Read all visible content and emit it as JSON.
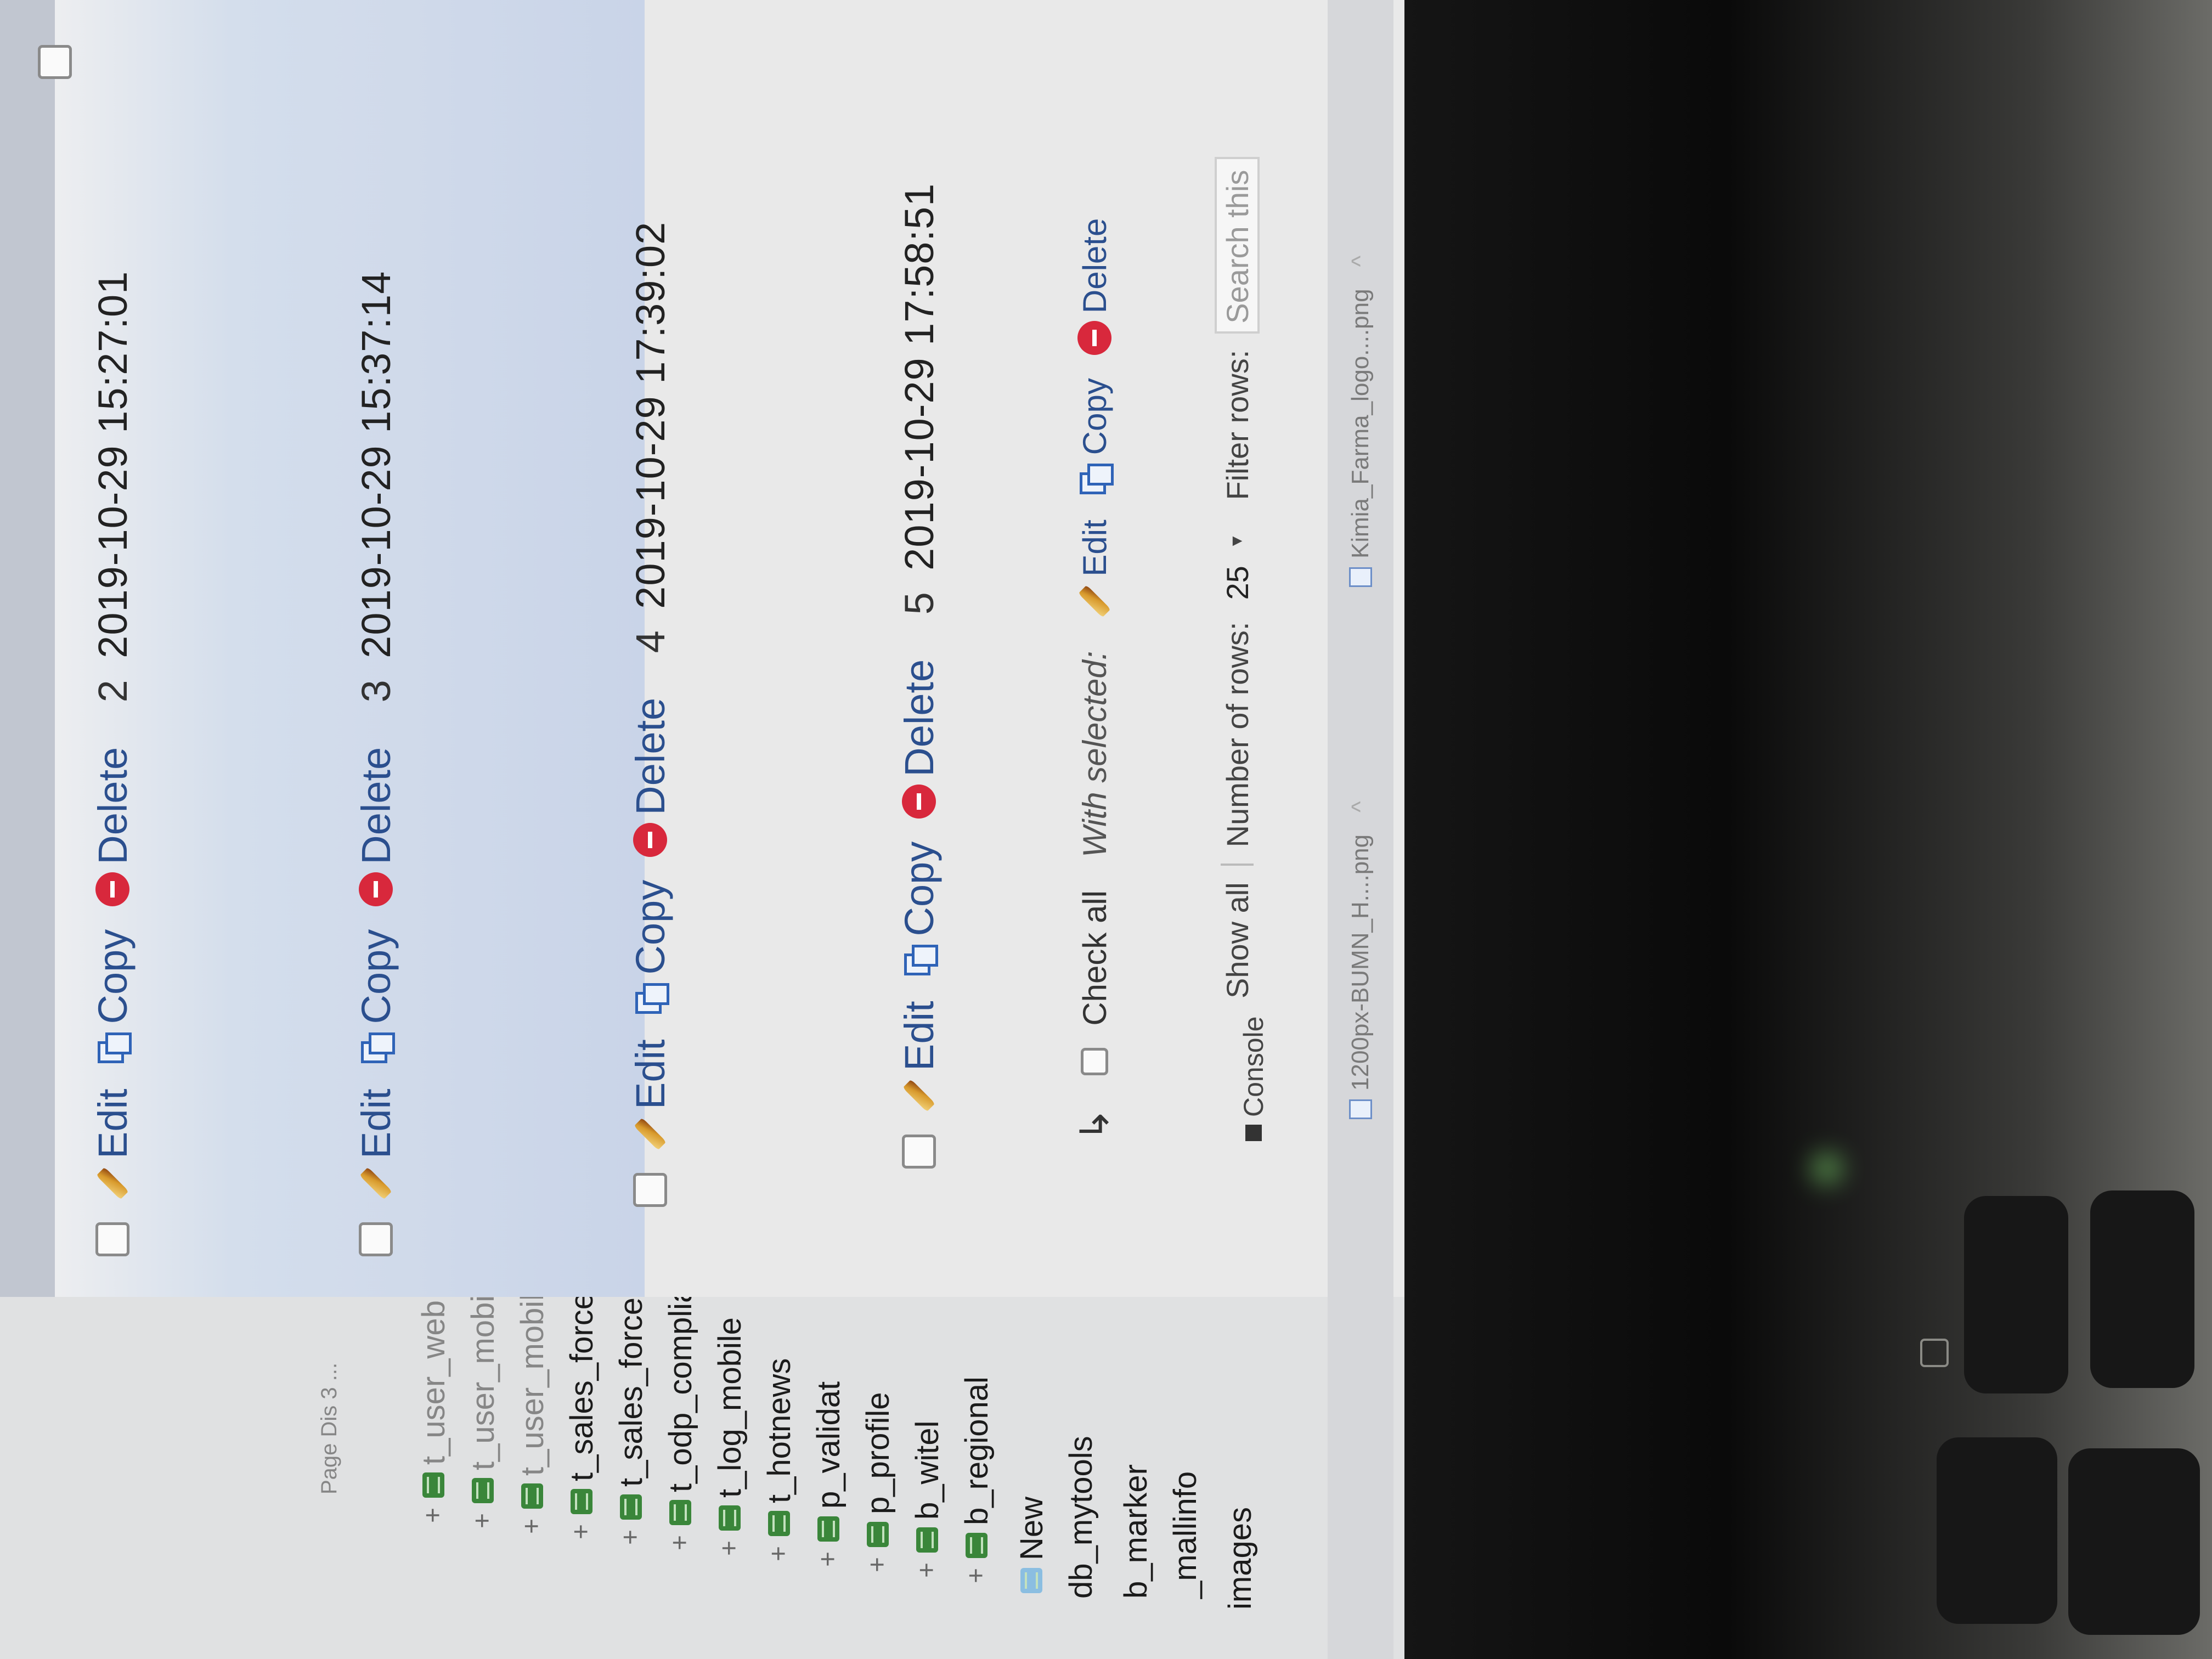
{
  "sidebar": {
    "items": [
      {
        "label": "images"
      },
      {
        "label": "_mallinfo"
      },
      {
        "label": "b_marker"
      },
      {
        "label": "db_mytools"
      },
      {
        "label": "New"
      },
      {
        "label": "b_regional"
      },
      {
        "label": "b_witel"
      },
      {
        "label": "p_profile"
      },
      {
        "label": "p_validat"
      },
      {
        "label": "t_hotnews"
      },
      {
        "label": "t_log_mobile"
      },
      {
        "label": "t_odp_compliance"
      },
      {
        "label": "t_sales_force"
      },
      {
        "label": "t_sales_force_mytools"
      },
      {
        "label": "t_user_mobile"
      },
      {
        "label": "t_user_mobile_copy"
      },
      {
        "label": "t_user_web"
      }
    ],
    "footer_text": "Page Dis 3 ..."
  },
  "actions": {
    "edit": "Edit",
    "copy": "Copy",
    "delete": "Delete"
  },
  "rows": [
    {
      "id": "2",
      "date": "2019-10-29 15:27:01"
    },
    {
      "id": "3",
      "date": "2019-10-29 15:37:14"
    },
    {
      "id": "4",
      "date": "2019-10-29 17:39:02"
    },
    {
      "id": "5",
      "date": "2019-10-29 17:58:51"
    }
  ],
  "with_selected": {
    "check_all": "Check all",
    "label": "With selected:",
    "edit": "Edit",
    "copy": "Copy",
    "delete": "Delete"
  },
  "paging": {
    "show_all": "Show all",
    "number_of_rows_label": "Number of rows:",
    "number_of_rows_value": "25",
    "filter_label": "Filter rows:",
    "filter_placeholder": "Search this"
  },
  "console": {
    "label": "Console"
  },
  "downloads": [
    {
      "name": "1200px-BUMN_H....png"
    },
    {
      "name": "Kimia_Farma_logo....png"
    }
  ],
  "colors": {
    "link": "#2b4f8e",
    "delete_icon": "#d8283c",
    "selected_row": "#cfdbef",
    "table_icon": "#3c8a3c"
  }
}
